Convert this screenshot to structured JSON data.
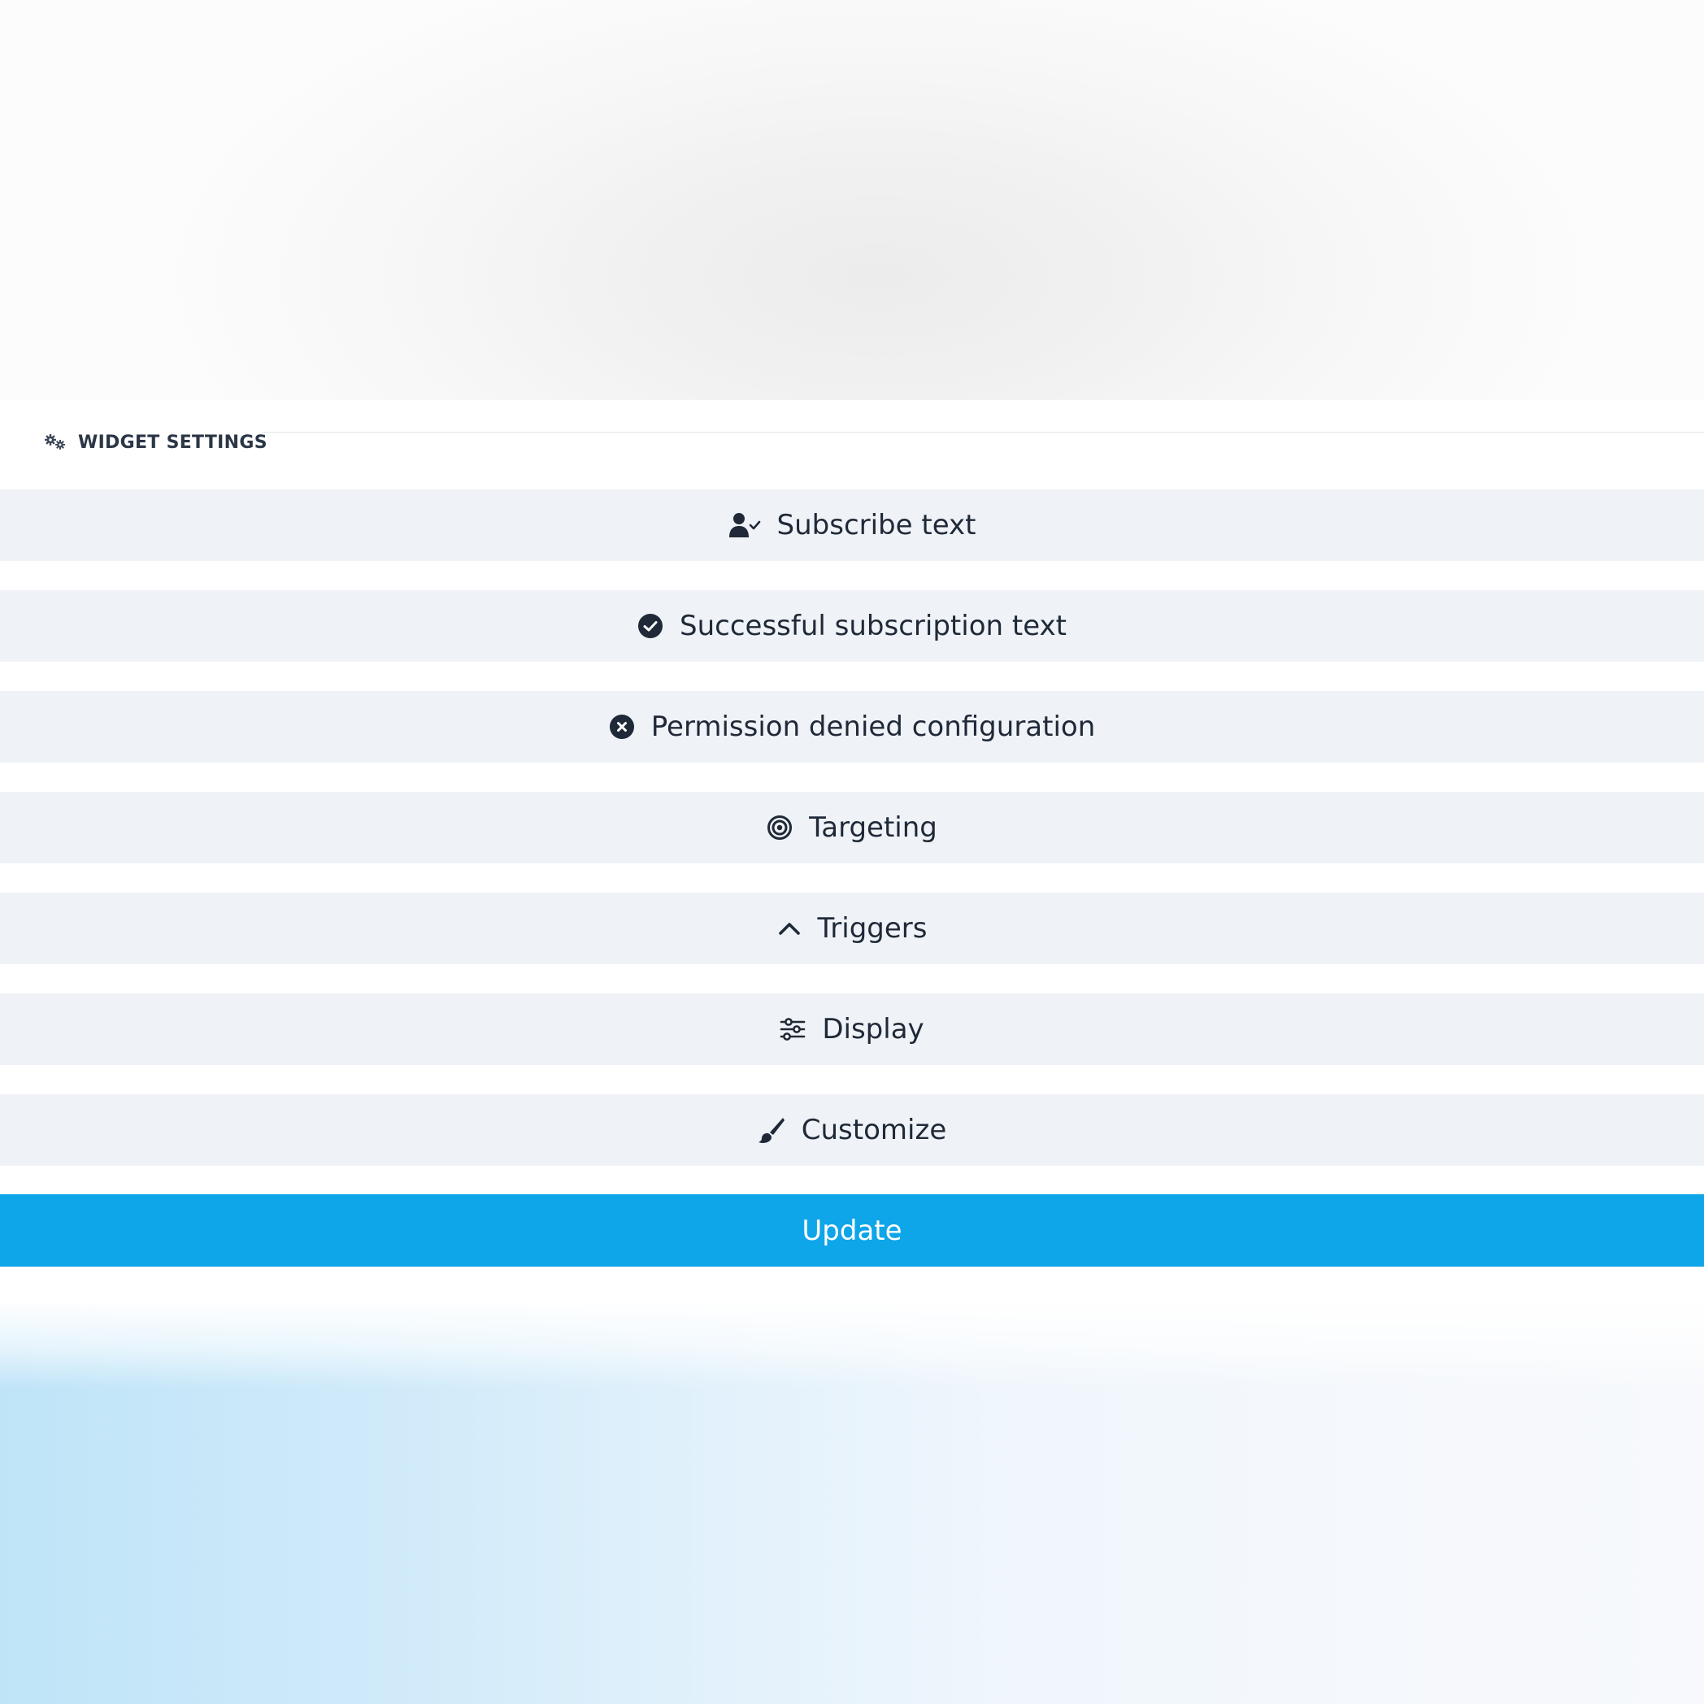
{
  "panel": {
    "title": "WIDGET SETTINGS",
    "title_icon": "cogs-icon"
  },
  "sections": [
    {
      "label": "Subscribe text",
      "icon": "user-check-icon"
    },
    {
      "label": "Successful subscription text",
      "icon": "check-circle-icon"
    },
    {
      "label": "Permission denied configuration",
      "icon": "x-circle-icon"
    },
    {
      "label": "Targeting",
      "icon": "target-icon"
    },
    {
      "label": "Triggers",
      "icon": "chevron-up-icon"
    },
    {
      "label": "Display",
      "icon": "sliders-icon"
    },
    {
      "label": "Customize",
      "icon": "paint-brush-icon"
    }
  ],
  "update_button": {
    "label": "Update"
  },
  "colors": {
    "accent": "#0ea5e9",
    "section_background": "#eff2f7",
    "text": "#1f2937",
    "header_text": "#2b3646"
  }
}
